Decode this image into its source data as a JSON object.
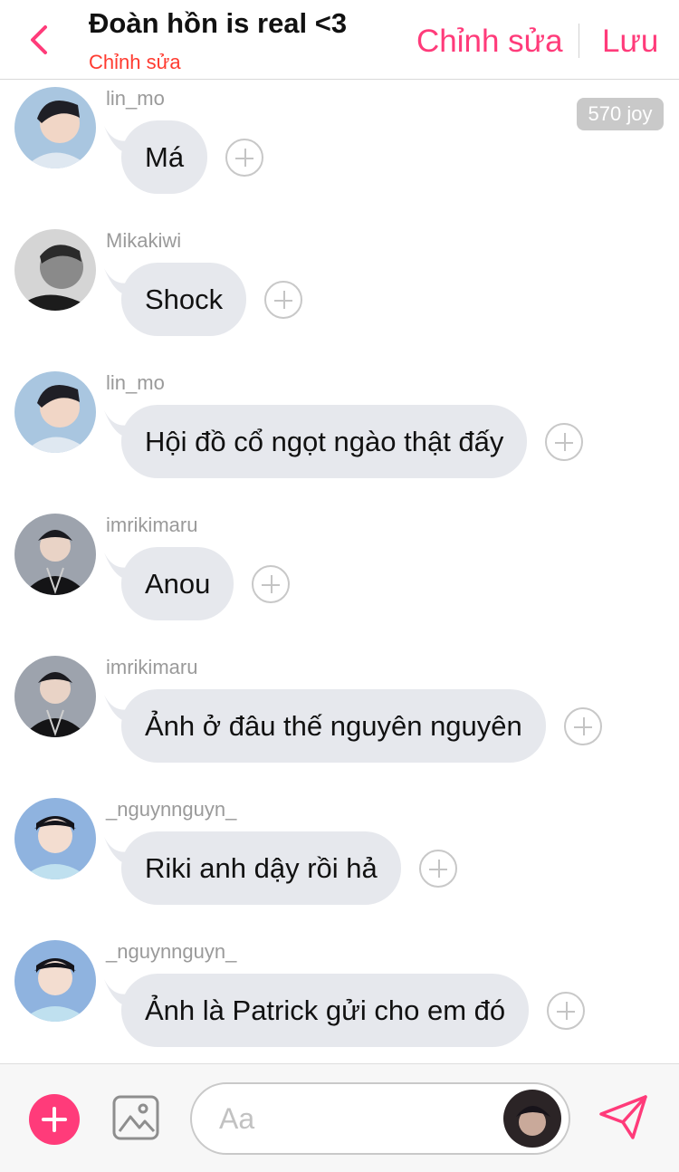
{
  "header": {
    "title": "Đoàn hồn is real <3",
    "subtitle": "Chỉnh sửa",
    "edit_label": "Chỉnh sửa",
    "save_label": "Lưu"
  },
  "joy_badge": "570 joy",
  "messages": [
    {
      "user": "lin_mo",
      "text": "Má",
      "avatar": "avatar-lin-mo"
    },
    {
      "user": "Mikakiwi",
      "text": "Shock",
      "avatar": "avatar-mikakiwi"
    },
    {
      "user": "lin_mo",
      "text": "Hội đồ cổ ngọt ngào thật đấy",
      "avatar": "avatar-lin-mo"
    },
    {
      "user": "imrikimaru",
      "text": "Anou",
      "avatar": "avatar-imrikimaru"
    },
    {
      "user": "imrikimaru",
      "text": "Ảnh ở đâu thế nguyên nguyên",
      "avatar": "avatar-imrikimaru"
    },
    {
      "user": "_nguynnguyn_",
      "text": "Riki anh dậy rồi hả",
      "avatar": "avatar-nguynnguyn"
    },
    {
      "user": "_nguynnguyn_",
      "text": "Ảnh là Patrick gửi cho em đó",
      "avatar": "avatar-nguynnguyn"
    }
  ],
  "composer": {
    "placeholder": "Aa"
  },
  "colors": {
    "accent": "#ff3b7a",
    "subtitle_red": "#ff3b30",
    "bubble": "#e6e8ed",
    "username_gray": "#9a9a9a"
  },
  "icons": [
    "back-chevron-icon",
    "plus-circle-icon",
    "image-icon",
    "send-icon",
    "add-reaction-icon"
  ]
}
